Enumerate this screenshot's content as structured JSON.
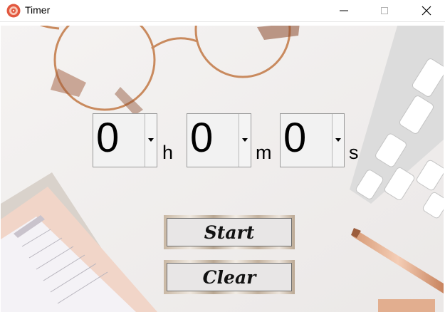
{
  "window": {
    "title": "Timer",
    "icon": "timer-app-icon",
    "controls": [
      "minimize-icon",
      "maximize-icon",
      "close-icon"
    ]
  },
  "timer": {
    "hours": {
      "value": "0",
      "unit": "h"
    },
    "minutes": {
      "value": "0",
      "unit": "m"
    },
    "seconds": {
      "value": "0",
      "unit": "s"
    }
  },
  "buttons": {
    "start_label": "Start",
    "clear_label": "Clear"
  },
  "colors": {
    "accent_icon": "#e0533b",
    "spin_bg": "#f2f2f2",
    "button_face": "#e8e6e6"
  }
}
